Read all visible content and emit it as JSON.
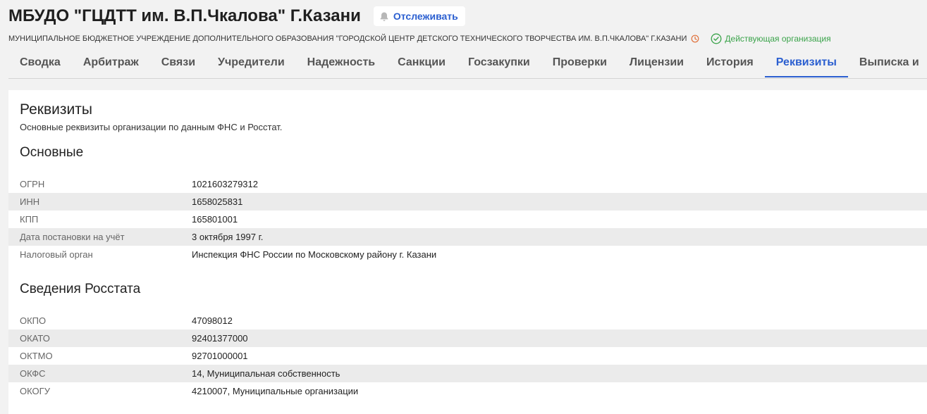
{
  "header": {
    "title": "МБУДО \"ГЦДТТ им. В.П.Чкалова\" Г.Казани",
    "follow_label": "Отслеживать",
    "full_name": "МУНИЦИПАЛЬНОЕ БЮДЖЕТНОЕ УЧРЕЖДЕНИЕ ДОПОЛНИТЕЛЬНОГО ОБРАЗОВАНИЯ \"ГОРОДСКОЙ ЦЕНТР ДЕТСКОГО ТЕХНИЧЕСКОГО ТВОРЧЕСТВА ИМ. В.П.ЧКАЛОВА\" Г.КАЗАНИ",
    "status": "Действующая организация",
    "status_color": "#3aa34a",
    "clock_color": "#e0703a"
  },
  "tabs": [
    {
      "label": "Сводка"
    },
    {
      "label": "Арбитраж"
    },
    {
      "label": "Связи"
    },
    {
      "label": "Учредители"
    },
    {
      "label": "Надежность"
    },
    {
      "label": "Санкции"
    },
    {
      "label": "Госзакупки"
    },
    {
      "label": "Проверки"
    },
    {
      "label": "Лицензии"
    },
    {
      "label": "История"
    },
    {
      "label": "Реквизиты",
      "active": true
    },
    {
      "label": "Выписка и"
    }
  ],
  "accent_color": "#2b5fd0",
  "card": {
    "title": "Реквизиты",
    "description": "Основные реквизиты организации по данным ФНС и Росстат.",
    "main_section": {
      "title": "Основные",
      "rows": [
        {
          "label": "ОГРН",
          "value": "1021603279312"
        },
        {
          "label": "ИНН",
          "value": "1658025831"
        },
        {
          "label": "КПП",
          "value": "165801001"
        },
        {
          "label": "Дата постановки на учёт",
          "value": "3 октября 1997 г."
        },
        {
          "label": "Налоговый орган",
          "value": "Инспекция ФНС России по Московскому району г. Казани"
        }
      ]
    },
    "rosstat_section": {
      "title": "Сведения Росстата",
      "rows": [
        {
          "label": "ОКПО",
          "value": "47098012"
        },
        {
          "label": "ОКАТО",
          "value": "92401377000"
        },
        {
          "label": "ОКТМО",
          "value": "92701000001"
        },
        {
          "label": "ОКФС",
          "value": "14, Муниципальная собственность"
        },
        {
          "label": "ОКОГУ",
          "value": "4210007, Муниципальные организации"
        }
      ]
    }
  }
}
